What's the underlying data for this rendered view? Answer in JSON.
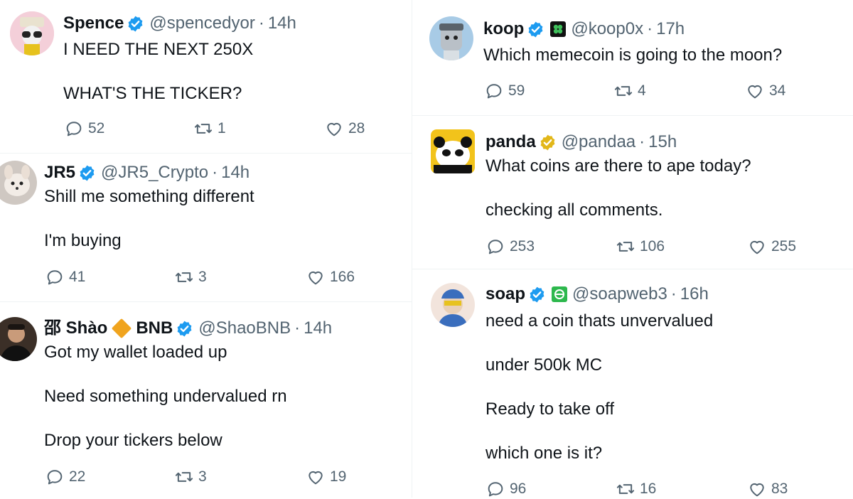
{
  "left_column": [
    {
      "name": "Spence",
      "handle": "@spencedyor",
      "time": "14h",
      "lines": [
        "I NEED THE NEXT 250X",
        "WHAT'S THE TICKER?"
      ],
      "replies": "52",
      "reposts": "1",
      "likes": "28"
    },
    {
      "name": "JR5",
      "handle": "@JR5_Crypto",
      "time": "14h",
      "lines": [
        "Shill me something different",
        "I'm buying"
      ],
      "replies": "41",
      "reposts": "3",
      "likes": "166"
    },
    {
      "name_prefix": "邵 Shào",
      "name_suffix": "BNB",
      "handle": "@ShaoBNB",
      "time": "14h",
      "lines": [
        "Got my wallet loaded up",
        "Need something undervalued rn",
        "Drop your tickers below"
      ],
      "replies": "22",
      "reposts": "3",
      "likes": "19"
    }
  ],
  "right_column": [
    {
      "name": "koop",
      "handle": "@koop0x",
      "time": "17h",
      "lines": [
        "Which memecoin is going to the moon?"
      ],
      "replies": "59",
      "reposts": "4",
      "likes": "34"
    },
    {
      "name": "panda",
      "handle": "@pandaa",
      "time": "15h",
      "lines": [
        "What coins are there to ape today?",
        "checking all comments."
      ],
      "replies": "253",
      "reposts": "106",
      "likes": "255"
    },
    {
      "name": "soap",
      "handle": "@soapweb3",
      "time": "16h",
      "lines": [
        "need a coin thats unvervalued",
        "under 500k MC",
        "Ready to take off",
        "which one is it?"
      ],
      "replies": "96",
      "reposts": "16",
      "likes": "83"
    }
  ],
  "separator": "·",
  "colors": {
    "verified_blue": "#1d9bf0",
    "verified_gold": "#e2b719",
    "muted": "#536471",
    "bnb_diamond": "#f0a41e"
  }
}
